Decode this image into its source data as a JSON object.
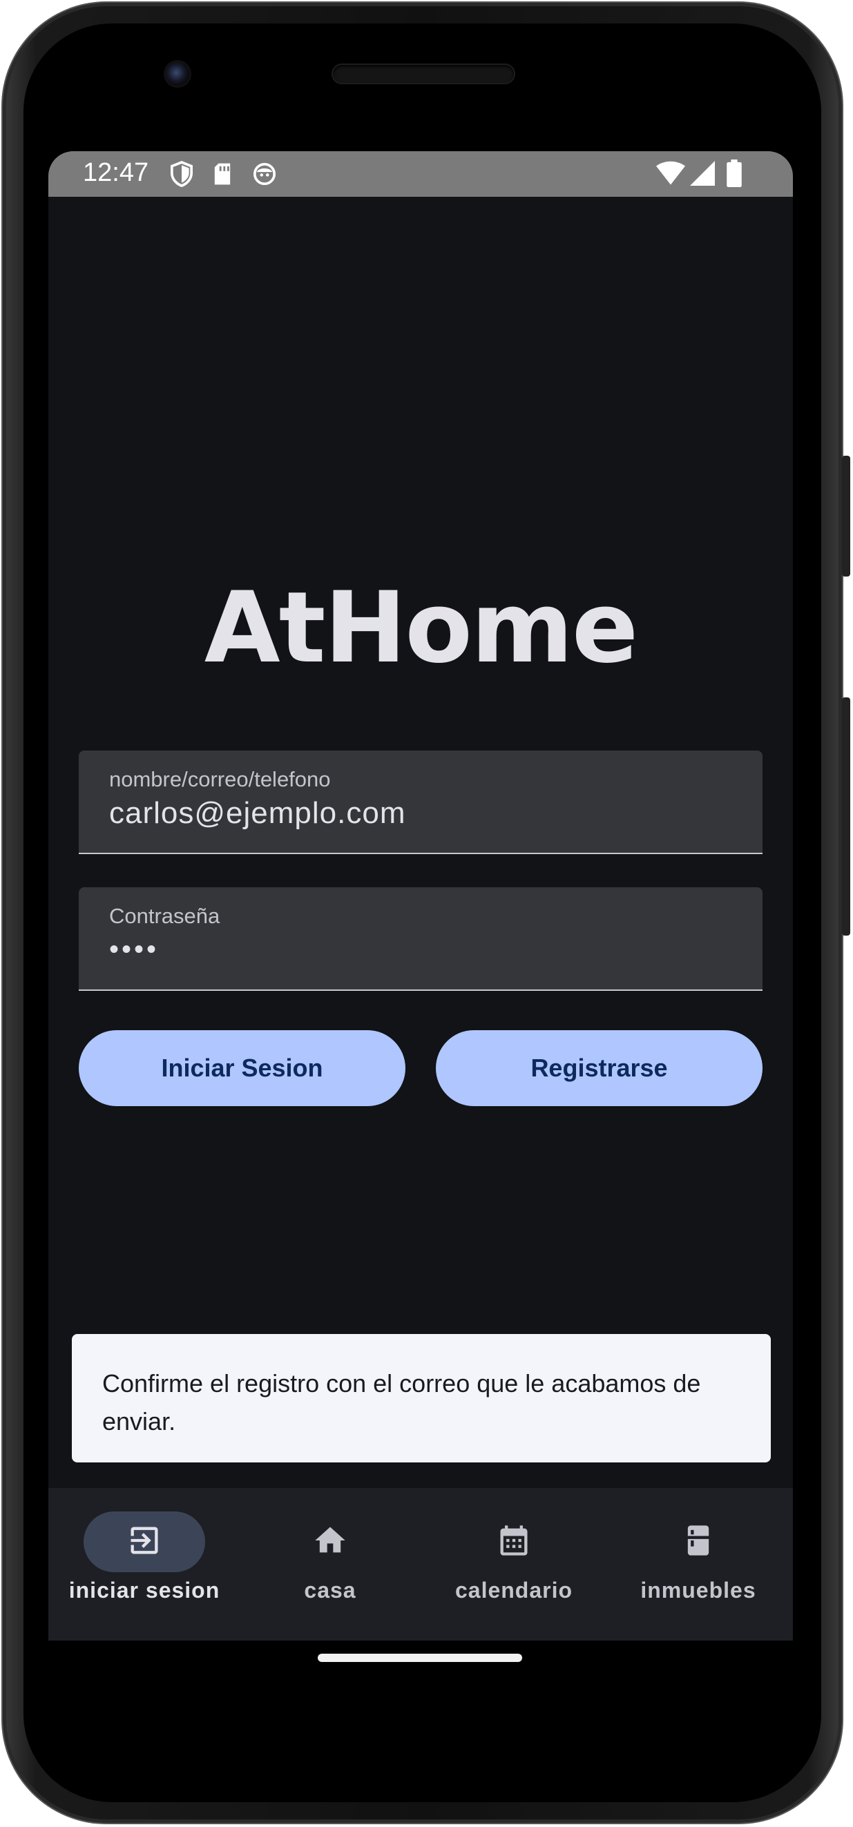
{
  "status_bar": {
    "time": "12:47",
    "left_icons": [
      "shield-icon",
      "sd-card-icon",
      "face-icon"
    ],
    "right_icons": [
      "wifi-icon",
      "signal-icon",
      "battery-icon"
    ]
  },
  "app": {
    "logo_text": "AtHome"
  },
  "form": {
    "username": {
      "label": "nombre/correo/telefono",
      "value": "carlos@ejemplo.com"
    },
    "password": {
      "label": "Contraseña",
      "value": "••••"
    },
    "login_button": "Iniciar Sesion",
    "register_button": "Registrarse"
  },
  "snackbar": {
    "message": "Confirme el registro con el correo que le acabamos de enviar."
  },
  "bottom_nav": {
    "items": [
      {
        "label": "iniciar sesion",
        "icon": "login-icon",
        "active": true
      },
      {
        "label": "casa",
        "icon": "home-icon",
        "active": false
      },
      {
        "label": "calendario",
        "icon": "calendar-icon",
        "active": false
      },
      {
        "label": "inmuebles",
        "icon": "fridge-icon",
        "active": false
      }
    ]
  },
  "colors": {
    "background": "#121316",
    "button": "#afc6ff",
    "button_text": "#0e2a5c",
    "nav_active_pill": "#3c4558",
    "snackbar": "#f4f4fb"
  }
}
